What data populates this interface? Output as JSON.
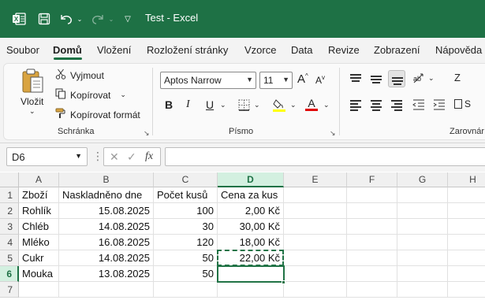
{
  "titlebar": {
    "title": "Test  -  Excel"
  },
  "menu": [
    "Soubor",
    "Domů",
    "Vložení",
    "Rozložení stránky",
    "Vzorce",
    "Data",
    "Revize",
    "Zobrazení",
    "Nápověda"
  ],
  "clipboard": {
    "paste_label": "Vložit",
    "cut_label": "Vyjmout",
    "copy_label": "Kopírovat",
    "format_painter_label": "Kopírovat formát",
    "group_label": "Schránka"
  },
  "font": {
    "font_name": "Aptos Narrow",
    "font_size": "11",
    "bold": "B",
    "italic": "I",
    "underline": "U",
    "group_label": "Písmo",
    "fill_color": "#ffff00",
    "font_color": "#e00000"
  },
  "alignment": {
    "group_label": "Zarovnár"
  },
  "formula_bar": {
    "cell_ref": "D6",
    "fx": "fx",
    "content": ""
  },
  "sheet": {
    "columns": [
      "A",
      "B",
      "C",
      "D",
      "E",
      "F",
      "G",
      "H"
    ],
    "selected_column": "D",
    "rows": [
      "1",
      "2",
      "3",
      "4",
      "5",
      "6",
      "7"
    ],
    "selected_row": "6",
    "cells": [
      [
        "Zboží",
        "Naskladněno dne",
        "Počet kusů",
        "Cena za kus"
      ],
      [
        "Rohlík",
        "15.08.2025",
        "100",
        "2,00 Kč"
      ],
      [
        "Chléb",
        "14.08.2025",
        "30",
        "30,00 Kč"
      ],
      [
        "Mléko",
        "16.08.2025",
        "120",
        "18,00 Kč"
      ],
      [
        "Cukr",
        "14.08.2025",
        "50",
        "22,00 Kč"
      ],
      [
        "Mouka",
        "13.08.2025",
        "50",
        ""
      ],
      [
        "",
        "",
        "",
        ""
      ]
    ]
  },
  "colors": {
    "accent": "#1e7145",
    "selection": "#217346"
  }
}
